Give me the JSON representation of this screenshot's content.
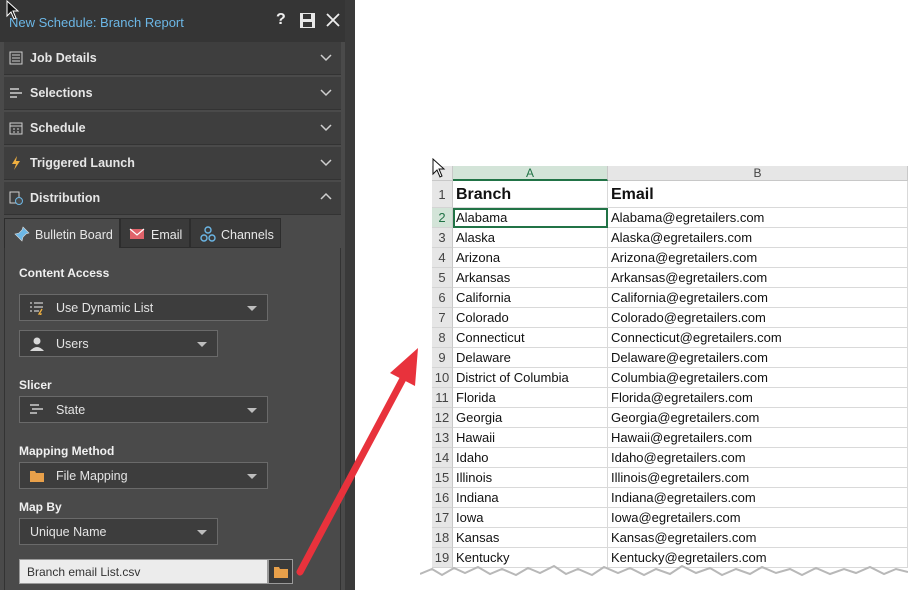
{
  "panel": {
    "title": "New Schedule: Branch Report",
    "title_icons": [
      "help-icon",
      "save-icon",
      "close-icon"
    ],
    "sections": [
      {
        "label": "Job Details",
        "icon": "job-details-icon",
        "expanded": false
      },
      {
        "label": "Selections",
        "icon": "selections-icon",
        "expanded": false
      },
      {
        "label": "Schedule",
        "icon": "calendar-icon",
        "expanded": false
      },
      {
        "label": "Triggered Launch",
        "icon": "lightning-icon",
        "expanded": false
      },
      {
        "label": "Distribution",
        "icon": "distribution-icon",
        "expanded": true
      }
    ],
    "tabs": [
      {
        "label": "Bulletin Board",
        "icon": "pin-icon",
        "active": true
      },
      {
        "label": "Email",
        "icon": "envelope-icon",
        "active": false
      },
      {
        "label": "Channels",
        "icon": "channels-icon",
        "active": false
      }
    ],
    "content_access": {
      "label": "Content Access",
      "list_mode": "Use Dynamic List",
      "target": "Users"
    },
    "slicer": {
      "label": "Slicer",
      "value": "State"
    },
    "mapping_method": {
      "label": "Mapping Method",
      "value": "File Mapping"
    },
    "map_by": {
      "label": "Map By",
      "value": "Unique Name"
    },
    "file": {
      "value": "Branch email List.csv"
    }
  },
  "sheet": {
    "columns": [
      "A",
      "B"
    ],
    "row_numbers": [
      "1",
      "2",
      "3",
      "4",
      "5",
      "6",
      "7",
      "8",
      "9",
      "10",
      "11",
      "12",
      "13",
      "14",
      "15",
      "16",
      "17",
      "18",
      "19"
    ],
    "header": {
      "a": "Branch",
      "b": "Email"
    },
    "rows": [
      {
        "a": "Alabama",
        "b": "Alabama@egretailers.com"
      },
      {
        "a": "Alaska",
        "b": "Alaska@egretailers.com"
      },
      {
        "a": "Arizona",
        "b": "Arizona@egretailers.com"
      },
      {
        "a": "Arkansas",
        "b": "Arkansas@egretailers.com"
      },
      {
        "a": "California",
        "b": "California@egretailers.com"
      },
      {
        "a": "Colorado",
        "b": "Colorado@egretailers.com"
      },
      {
        "a": "Connecticut",
        "b": "Connecticut@egretailers.com"
      },
      {
        "a": "Delaware",
        "b": "Delaware@egretailers.com"
      },
      {
        "a": "District of Columbia",
        "b": "Columbia@egretailers.com"
      },
      {
        "a": "Florida",
        "b": "Florida@egretailers.com"
      },
      {
        "a": "Georgia",
        "b": "Georgia@egretailers.com"
      },
      {
        "a": "Hawaii",
        "b": "Hawaii@egretailers.com"
      },
      {
        "a": "Idaho",
        "b": "Idaho@egretailers.com"
      },
      {
        "a": "Illinois",
        "b": "Illinois@egretailers.com"
      },
      {
        "a": "Indiana",
        "b": "Indiana@egretailers.com"
      },
      {
        "a": "Iowa",
        "b": "Iowa@egretailers.com"
      },
      {
        "a": "Kansas",
        "b": "Kansas@egretailers.com"
      },
      {
        "a": "Kentucky",
        "b": "Kentucky@egretailers.com"
      }
    ]
  },
  "colors": {
    "panel_bg": "#4a4a4a",
    "title_blue": "#6cb7e6",
    "excel_green": "#217346",
    "arrow_red": "#e8323c",
    "folder_orange": "#e8a04a"
  }
}
